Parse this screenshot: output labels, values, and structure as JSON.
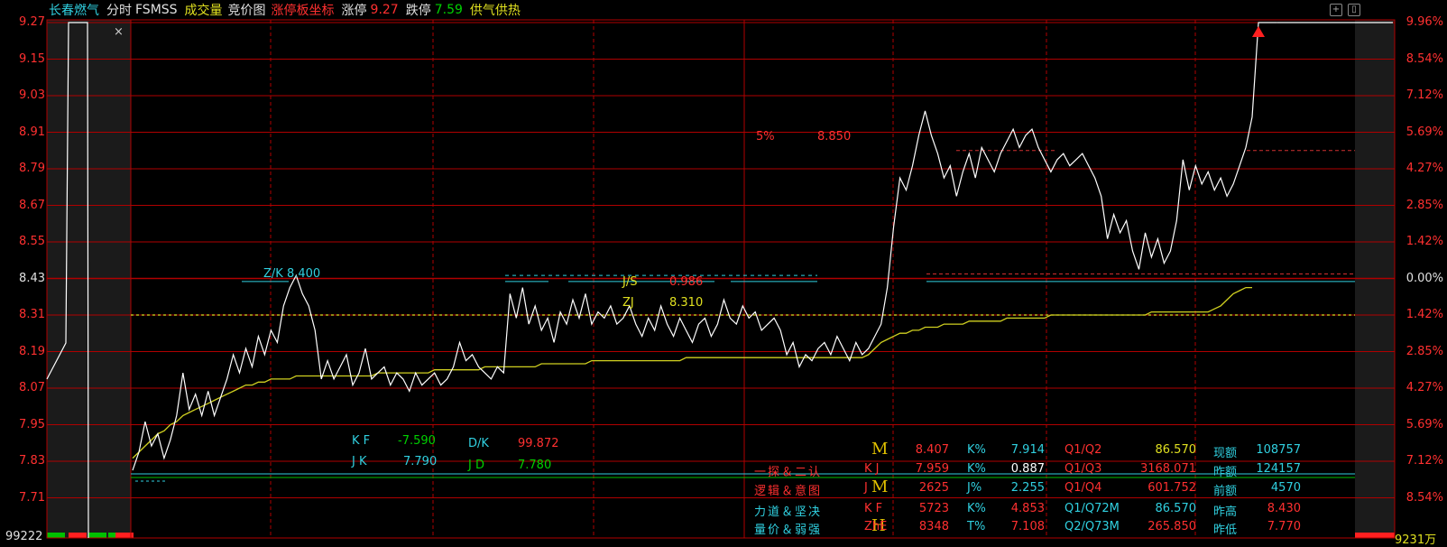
{
  "header": {
    "stock_name": "长春燃气",
    "view_label": "分时",
    "indicator": "FSMSS",
    "volume_label": "成交量",
    "auction_label": "竞价图",
    "limit_coord_label": "涨停板坐标",
    "up_limit_label": "涨停",
    "up_limit_value": "9.27",
    "down_limit_label": "跌停",
    "down_limit_value": "7.59",
    "concept": "供气供热"
  },
  "close_symbol": "×",
  "colors": {
    "price_up": "#ff3030",
    "price_down": "#00d000",
    "cyan": "#30d0e0",
    "yellow": "#e0e020",
    "grid_red": "#b00000",
    "price_line": "#ffffff",
    "avg_line": "#d0d020"
  },
  "chart_data": {
    "type": "line",
    "y_ticks": [
      "9.27",
      "9.15",
      "9.03",
      "8.91",
      "8.79",
      "8.67",
      "8.55",
      "8.43",
      "8.31",
      "8.19",
      "8.07",
      "7.95",
      "7.83",
      "7.71"
    ],
    "pct_ticks": [
      "9.96%",
      "8.54%",
      "7.12%",
      "5.69%",
      "4.27%",
      "2.85%",
      "1.42%",
      "0.00%",
      "1.42%",
      "2.85%",
      "4.27%",
      "5.69%",
      "7.12%",
      "8.54%"
    ],
    "ylim": [
      7.65,
      9.27
    ],
    "prev_close": 8.43,
    "volume_left": "99222",
    "volume_right": "9231万",
    "price": [
      7.8,
      7.86,
      7.96,
      7.88,
      7.92,
      7.84,
      7.9,
      7.98,
      8.12,
      8.0,
      8.05,
      7.98,
      8.06,
      7.98,
      8.04,
      8.1,
      8.18,
      8.12,
      8.2,
      8.14,
      8.24,
      8.18,
      8.26,
      8.22,
      8.34,
      8.4,
      8.44,
      8.38,
      8.34,
      8.26,
      8.1,
      8.16,
      8.1,
      8.14,
      8.18,
      8.08,
      8.12,
      8.2,
      8.1,
      8.12,
      8.14,
      8.08,
      8.12,
      8.1,
      8.06,
      8.12,
      8.08,
      8.1,
      8.12,
      8.08,
      8.1,
      8.14,
      8.22,
      8.16,
      8.18,
      8.14,
      8.12,
      8.1,
      8.14,
      8.12,
      8.38,
      8.3,
      8.4,
      8.28,
      8.34,
      8.26,
      8.3,
      8.22,
      8.32,
      8.28,
      8.36,
      8.3,
      8.38,
      8.28,
      8.32,
      8.3,
      8.34,
      8.28,
      8.3,
      8.34,
      8.28,
      8.24,
      8.3,
      8.26,
      8.34,
      8.28,
      8.24,
      8.3,
      8.26,
      8.22,
      8.28,
      8.3,
      8.24,
      8.28,
      8.36,
      8.3,
      8.28,
      8.34,
      8.3,
      8.32,
      8.26,
      8.28,
      8.3,
      8.26,
      8.18,
      8.22,
      8.14,
      8.18,
      8.16,
      8.2,
      8.22,
      8.18,
      8.24,
      8.2,
      8.16,
      8.22,
      8.18,
      8.2,
      8.24,
      8.28,
      8.4,
      8.6,
      8.76,
      8.72,
      8.8,
      8.9,
      8.98,
      8.9,
      8.84,
      8.76,
      8.8,
      8.7,
      8.78,
      8.84,
      8.76,
      8.86,
      8.82,
      8.78,
      8.84,
      8.88,
      8.92,
      8.86,
      8.9,
      8.92,
      8.86,
      8.82,
      8.78,
      8.82,
      8.84,
      8.8,
      8.82,
      8.84,
      8.8,
      8.76,
      8.7,
      8.56,
      8.64,
      8.58,
      8.62,
      8.52,
      8.46,
      8.58,
      8.5,
      8.56,
      8.48,
      8.52,
      8.62,
      8.82,
      8.72,
      8.8,
      8.74,
      8.78,
      8.72,
      8.76,
      8.7,
      8.74,
      8.8,
      8.86,
      8.96,
      9.27,
      9.27,
      9.27,
      9.27
    ],
    "avg": [
      7.84,
      7.86,
      7.88,
      7.9,
      7.92,
      7.93,
      7.95,
      7.96,
      7.98,
      7.99,
      8.0,
      8.01,
      8.02,
      8.03,
      8.04,
      8.05,
      8.06,
      8.07,
      8.08,
      8.08,
      8.09,
      8.09,
      8.1,
      8.1,
      8.1,
      8.1,
      8.11,
      8.11,
      8.11,
      8.11,
      8.11,
      8.11,
      8.11,
      8.11,
      8.11,
      8.11,
      8.11,
      8.11,
      8.11,
      8.12,
      8.12,
      8.12,
      8.12,
      8.12,
      8.12,
      8.12,
      8.12,
      8.12,
      8.13,
      8.13,
      8.13,
      8.13,
      8.13,
      8.13,
      8.13,
      8.13,
      8.14,
      8.14,
      8.14,
      8.14,
      8.14,
      8.14,
      8.14,
      8.14,
      8.14,
      8.15,
      8.15,
      8.15,
      8.15,
      8.15,
      8.15,
      8.15,
      8.15,
      8.16,
      8.16,
      8.16,
      8.16,
      8.16,
      8.16,
      8.16,
      8.16,
      8.16,
      8.16,
      8.16,
      8.16,
      8.16,
      8.16,
      8.16,
      8.17,
      8.17,
      8.17,
      8.17,
      8.17,
      8.17,
      8.17,
      8.17,
      8.17,
      8.17,
      8.17,
      8.17,
      8.17,
      8.17,
      8.17,
      8.17,
      8.17,
      8.17,
      8.17,
      8.17,
      8.17,
      8.17,
      8.17,
      8.17,
      8.17,
      8.17,
      8.17,
      8.17,
      8.17,
      8.18,
      8.2,
      8.22,
      8.23,
      8.24,
      8.25,
      8.25,
      8.26,
      8.26,
      8.27,
      8.27,
      8.27,
      8.28,
      8.28,
      8.28,
      8.28,
      8.29,
      8.29,
      8.29,
      8.29,
      8.29,
      8.29,
      8.3,
      8.3,
      8.3,
      8.3,
      8.3,
      8.3,
      8.3,
      8.31,
      8.31,
      8.31,
      8.31,
      8.31,
      8.31,
      8.31,
      8.31,
      8.31,
      8.31,
      8.31,
      8.31,
      8.31,
      8.31,
      8.31,
      8.31,
      8.32,
      8.32,
      8.32,
      8.32,
      8.32,
      8.32,
      8.32,
      8.32,
      8.32,
      8.32,
      8.33,
      8.34,
      8.36,
      8.38,
      8.39,
      8.4,
      8.4
    ]
  },
  "annotations": {
    "zk": "Z/K  8.400",
    "js": "J/S",
    "js_val": "0.986",
    "zj": "ZJ",
    "zj_val": "8.310",
    "pct5": "5%",
    "pct5_val": "8.850",
    "kf_label": "K F",
    "kf_val": "-7.590",
    "dk_label": "D/K",
    "dk_val": "99.872",
    "jk_label": "J K",
    "jk_val": "7.790",
    "jd_label": "J  D",
    "jd_val": "7.780"
  },
  "panel": {
    "rows": [
      {
        "left": "",
        "mark": "M",
        "code": "",
        "v1": "8.407",
        "k": "K%",
        "kv": "7.914",
        "q": "Q1/Q2",
        "qv": "86.570",
        "lbl": "现额",
        "lv": "108757"
      },
      {
        "left": "一探＆二认",
        "mark": "",
        "code": "K J",
        "v1": "7.959",
        "k": "K%",
        "kv": "0.887",
        "q": "Q1/Q3",
        "qv": "3168.071",
        "lbl": "昨额",
        "lv": "124157"
      },
      {
        "left": "逻辑＆意图",
        "mark": "M",
        "code": "J",
        "v1": "2625",
        "k": "J%",
        "kv": "2.255",
        "q": "Q1/Q4",
        "qv": "601.752",
        "lbl": "前额",
        "lv": "4570"
      },
      {
        "left": "力道＆坚决",
        "mark": "",
        "code": "K F",
        "v1": "5723",
        "k": "K%",
        "kv": "4.853",
        "q": "Q1/Q72M",
        "qv": "86.570",
        "lbl": "昨高",
        "lv": "8.430"
      },
      {
        "left": "量价＆弱强",
        "mark": "H",
        "code": "ZhE",
        "v1": "8348",
        "k": "T%",
        "kv": "7.108",
        "q": "Q2/Q73M",
        "qv": "265.850",
        "lbl": "昨低",
        "lv": "7.770"
      }
    ]
  }
}
